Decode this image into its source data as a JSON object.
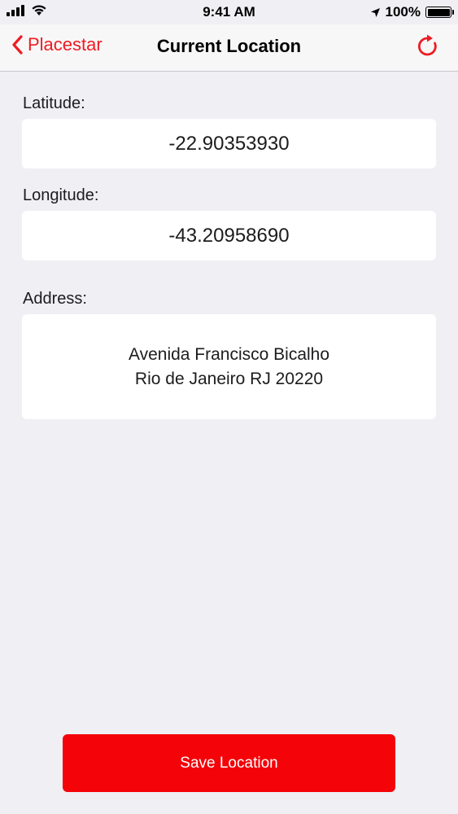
{
  "status_bar": {
    "time": "9:41 AM",
    "battery_percent": "100%",
    "battery_level": 1.0,
    "signal_bars": 4,
    "icons": [
      "signal-icon",
      "wifi-icon",
      "location-arrow-icon",
      "battery-icon"
    ]
  },
  "nav": {
    "back_label": "Placestar",
    "title": "Current Location",
    "back_icon": "chevron-left-icon",
    "refresh_icon": "refresh-icon"
  },
  "latitude": {
    "label": "Latitude:",
    "value": "-22.90353930"
  },
  "longitude": {
    "label": "Longitude:",
    "value": "-43.20958690"
  },
  "address": {
    "label": "Address:",
    "lines": [
      "Avenida Francisco Bicalho",
      "Rio de Janeiro RJ 20220"
    ]
  },
  "save_button": {
    "label": "Save Location"
  },
  "colors": {
    "accent": "#ee1c24",
    "button": "#f40309",
    "background": "#efeff4",
    "card": "#ffffff"
  }
}
